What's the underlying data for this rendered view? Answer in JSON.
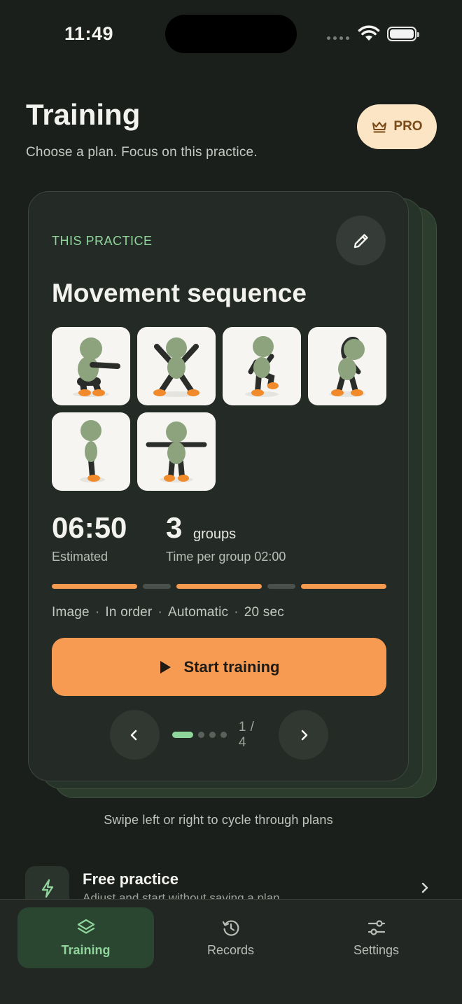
{
  "status_bar": {
    "time": "11:49"
  },
  "header": {
    "title": "Training",
    "subtitle": "Choose a plan. Focus on this practice.",
    "pro_label": "PRO"
  },
  "card": {
    "eyebrow": "THIS PRACTICE",
    "title": "Movement sequence",
    "exercises": [
      {
        "icon": "squat-figure"
      },
      {
        "icon": "jumping-jack-figure"
      },
      {
        "icon": "high-knees-figure"
      },
      {
        "icon": "side-stretch-figure"
      },
      {
        "icon": "standing-figure"
      },
      {
        "icon": "arms-out-figure"
      }
    ],
    "estimated_time": "06:50",
    "estimated_label": "Estimated",
    "groups_count": "3",
    "groups_unit": "groups",
    "time_per_group": "Time per group 02:00",
    "meta": [
      "Image",
      "In order",
      "Automatic",
      "20 sec"
    ],
    "meta_separator": "·",
    "start_label": "Start training",
    "pager": {
      "current_page": 1,
      "total_pages": 4,
      "label": "1 / 4"
    }
  },
  "swipe_hint": "Swipe left or right to cycle through plans",
  "free_practice": {
    "title": "Free practice",
    "subtitle": "Adjust and start without saving a plan"
  },
  "tabs": [
    {
      "label": "Training",
      "icon": "layers-icon",
      "active": true
    },
    {
      "label": "Records",
      "icon": "history-icon",
      "active": false
    },
    {
      "label": "Settings",
      "icon": "sliders-icon",
      "active": false
    }
  ],
  "colors": {
    "background": "#1b1f1c",
    "accent_green": "#8fd49b",
    "accent_orange": "#f89b52",
    "pro_bg": "#fbe5c5"
  }
}
